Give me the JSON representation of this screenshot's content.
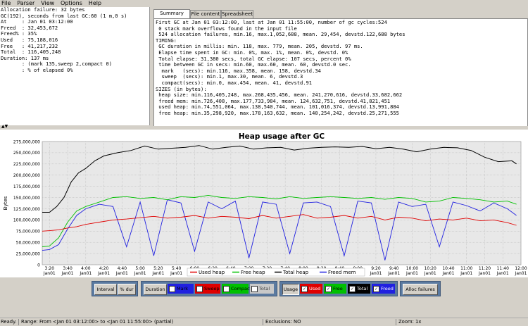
{
  "menu": [
    "File",
    "Parser",
    "View",
    "Options",
    "Help"
  ],
  "left_panel": {
    "lines": [
      "Allocation failure: 32 bytes",
      "GC(192), seconds from last GC:60 (1 m,0 s)",
      "At     : Jan 01 03:12:00",
      "Freed  : 32,453,672",
      "Freed% : 35%",
      "Used   : 75,188,016",
      "Free   : 41,217,232",
      "Total  : 116,405,248",
      "Duration: 137 ms",
      "       : (mark 135,sweep 2,compact 0)",
      "       : % of elapsed 0%"
    ]
  },
  "tabs": [
    {
      "label": "Summary data",
      "active": true
    },
    {
      "label": "File content",
      "active": false
    },
    {
      "label": "Spreadsheet",
      "active": false
    }
  ],
  "summary": {
    "lines": [
      "First GC at Jan 01 03:12:00, last at Jan 01 11:55:00, number of gc cycles:524",
      " 0 stack mark overflows found in the input file",
      " 524 allocation failures, min.16, max.1,052,688, mean. 29,454, devstd.122,688 bytes",
      "TIMING:",
      " GC duration in millis: min. 118, max. 779, mean. 205, devstd. 97 ms.",
      " Elapse time spent in GC: min. 0%, max. 1%, mean. 0%, devstd. 0%",
      " Total elapse: 31,380 secs, total GC elapse: 107 secs, percent 0%",
      " time between GC in secs: min.60, max.60, mean. 60, devstd.0 sec.",
      "  mark   (secs): min.116, max.358, mean. 158, devstd.34",
      "  sweep  (secs): min.1, max.30, mean. 6, devstd.3",
      "  compact(secs): min.0, max.454, mean. 41, devstd.91",
      "SIZES (in bytes):",
      " heap size: min.116,405,248, max.268,435,456, mean. 241,270,616, devstd.33,682,662",
      " freed mem: min.726,408, max.177,733,984, mean. 124,632,751, devstd.41,821,451",
      " used heap: min.74,551,064, max.138,540,744, mean. 101,016,374, devstd.13,991,884",
      " free heap: min.35,298,920, max.178,163,632, mean. 140,254,242, devstd.25,271,555"
    ]
  },
  "chart_data": {
    "type": "line",
    "title": "Heap usage after GC",
    "ylabel": "Bytes",
    "xlabel": "",
    "ylim": [
      0,
      275000000
    ],
    "grid": true,
    "legend_placement": "bottom",
    "y_ticks": [
      0,
      25000000,
      50000000,
      75000000,
      100000000,
      125000000,
      150000000,
      175000000,
      200000000,
      225000000,
      250000000,
      275000000
    ],
    "y_tick_labels": [
      "0",
      "25,000,000",
      "50,000,000",
      "75,000,000",
      "100,000,000",
      "125,000,000",
      "150,000,000",
      "175,000,000",
      "200,000,000",
      "225,000,000",
      "250,000,000",
      "275,000,000"
    ],
    "x_ticks": [
      "03:20",
      "03:40",
      "04:00",
      "04:20",
      "04:40",
      "05:00",
      "05:20",
      "05:40",
      "06:00",
      "06:20",
      "06:40",
      "07:00",
      "07:20",
      "07:40",
      "08:00",
      "08:20",
      "08:40",
      "09:00",
      "09:20",
      "09:40",
      "10:00",
      "10:20",
      "10:40",
      "11:00",
      "11:20",
      "11:40",
      "12:00"
    ],
    "x_tick_labels": [
      {
        "time": "3:20",
        "date": "Jan01"
      },
      {
        "time": "3:40",
        "date": "Jan01"
      },
      {
        "time": "4:00",
        "date": "Jan01"
      },
      {
        "time": "4:20",
        "date": "Jan01"
      },
      {
        "time": "4:40",
        "date": "Jan01"
      },
      {
        "time": "5:00",
        "date": "Jan01"
      },
      {
        "time": "5:20",
        "date": "Jan01"
      },
      {
        "time": "5:40",
        "date": "Jan01"
      },
      {
        "time": "6:00",
        "date": "Jan01"
      },
      {
        "time": "6:20",
        "date": "Jan01"
      },
      {
        "time": "6:40",
        "date": "Jan01"
      },
      {
        "time": "7:00",
        "date": "Jan01"
      },
      {
        "time": "7:20",
        "date": "Jan01"
      },
      {
        "time": "7:40",
        "date": "Jan01"
      },
      {
        "time": "8:00",
        "date": "Jan01"
      },
      {
        "time": "8:20",
        "date": "Jan01"
      },
      {
        "time": "8:40",
        "date": "Jan01"
      },
      {
        "time": "9:00",
        "date": "Jan01"
      },
      {
        "time": "9:20",
        "date": "Jan01"
      },
      {
        "time": "9:40",
        "date": "Jan01"
      },
      {
        "time": "10:00",
        "date": "Jan01"
      },
      {
        "time": "10:20",
        "date": "Jan01"
      },
      {
        "time": "10:40",
        "date": "Jan01"
      },
      {
        "time": "11:00",
        "date": "Jan01"
      },
      {
        "time": "11:20",
        "date": "Jan01"
      },
      {
        "time": "11:40",
        "date": "Jan01"
      },
      {
        "time": "12:00",
        "date": "Jan01"
      }
    ],
    "x_range": [
      "03:12",
      "11:55"
    ],
    "series": [
      {
        "name": "Total heap",
        "color": "#000000",
        "x": [
          "03:12",
          "03:20",
          "03:28",
          "03:36",
          "03:44",
          "03:52",
          "04:00",
          "04:10",
          "04:20",
          "04:35",
          "04:50",
          "05:05",
          "05:20",
          "05:35",
          "05:50",
          "06:05",
          "06:20",
          "06:35",
          "06:50",
          "07:05",
          "07:20",
          "07:35",
          "07:50",
          "08:05",
          "08:20",
          "08:35",
          "08:50",
          "09:05",
          "09:20",
          "09:35",
          "09:50",
          "10:05",
          "10:20",
          "10:35",
          "10:50",
          "11:05",
          "11:20",
          "11:35",
          "11:50",
          "11:55"
        ],
        "values": [
          117000000,
          117000000,
          130000000,
          150000000,
          185000000,
          205000000,
          215000000,
          232000000,
          243000000,
          250000000,
          255000000,
          265000000,
          258000000,
          260000000,
          262000000,
          266000000,
          258000000,
          262000000,
          265000000,
          258000000,
          261000000,
          262000000,
          256000000,
          260000000,
          262000000,
          263000000,
          262000000,
          264000000,
          259000000,
          262000000,
          258000000,
          252000000,
          258000000,
          262000000,
          261000000,
          255000000,
          240000000,
          230000000,
          232000000,
          225000000
        ]
      },
      {
        "name": "Free heap",
        "color": "#00c000",
        "x": [
          "03:12",
          "03:20",
          "03:30",
          "03:40",
          "03:50",
          "04:00",
          "04:15",
          "04:30",
          "04:45",
          "05:00",
          "05:15",
          "05:30",
          "05:45",
          "06:00",
          "06:15",
          "06:30",
          "06:45",
          "07:00",
          "07:15",
          "07:30",
          "07:45",
          "08:00",
          "08:15",
          "08:30",
          "08:45",
          "09:00",
          "09:15",
          "09:30",
          "09:45",
          "10:00",
          "10:15",
          "10:30",
          "10:45",
          "11:00",
          "11:15",
          "11:30",
          "11:45",
          "11:55"
        ],
        "values": [
          40000000,
          42000000,
          60000000,
          95000000,
          120000000,
          130000000,
          140000000,
          150000000,
          152000000,
          148000000,
          150000000,
          145000000,
          152000000,
          150000000,
          155000000,
          150000000,
          148000000,
          152000000,
          150000000,
          147000000,
          152000000,
          148000000,
          150000000,
          152000000,
          150000000,
          148000000,
          150000000,
          146000000,
          150000000,
          148000000,
          140000000,
          142000000,
          150000000,
          148000000,
          145000000,
          140000000,
          142000000,
          135000000
        ]
      },
      {
        "name": "Used heap",
        "color": "#e00000",
        "x": [
          "03:12",
          "03:20",
          "03:30",
          "03:40",
          "03:50",
          "04:00",
          "04:15",
          "04:30",
          "04:45",
          "05:00",
          "05:15",
          "05:30",
          "05:45",
          "06:00",
          "06:15",
          "06:30",
          "06:45",
          "07:00",
          "07:15",
          "07:30",
          "07:45",
          "08:00",
          "08:15",
          "08:30",
          "08:45",
          "09:00",
          "09:15",
          "09:30",
          "09:45",
          "10:00",
          "10:15",
          "10:30",
          "10:45",
          "11:00",
          "11:15",
          "11:30",
          "11:45",
          "11:55"
        ],
        "values": [
          75000000,
          76000000,
          78000000,
          82000000,
          85000000,
          90000000,
          95000000,
          100000000,
          102000000,
          105000000,
          108000000,
          104000000,
          106000000,
          110000000,
          104000000,
          108000000,
          106000000,
          103000000,
          110000000,
          104000000,
          108000000,
          112000000,
          104000000,
          106000000,
          110000000,
          104000000,
          108000000,
          100000000,
          106000000,
          104000000,
          98000000,
          102000000,
          100000000,
          104000000,
          98000000,
          100000000,
          94000000,
          88000000
        ]
      },
      {
        "name": "Freed mem",
        "color": "#2020e0",
        "x": [
          "03:12",
          "03:20",
          "03:30",
          "03:40",
          "03:50",
          "04:00",
          "04:15",
          "04:30",
          "04:45",
          "05:00",
          "05:15",
          "05:30",
          "05:45",
          "06:00",
          "06:15",
          "06:30",
          "06:45",
          "07:00",
          "07:15",
          "07:30",
          "07:45",
          "08:00",
          "08:15",
          "08:30",
          "08:45",
          "09:00",
          "09:15",
          "09:30",
          "09:45",
          "10:00",
          "10:15",
          "10:30",
          "10:45",
          "11:00",
          "11:15",
          "11:30",
          "11:45",
          "11:55"
        ],
        "values": [
          32000000,
          34000000,
          45000000,
          80000000,
          110000000,
          125000000,
          135000000,
          130000000,
          40000000,
          140000000,
          20000000,
          145000000,
          138000000,
          30000000,
          140000000,
          125000000,
          142000000,
          15000000,
          140000000,
          135000000,
          25000000,
          138000000,
          140000000,
          130000000,
          20000000,
          142000000,
          138000000,
          10000000,
          140000000,
          130000000,
          135000000,
          40000000,
          140000000,
          132000000,
          120000000,
          138000000,
          125000000,
          110000000
        ]
      }
    ]
  },
  "legend": [
    "Used heap",
    "Free heap",
    "Total heap",
    "Freed mem"
  ],
  "toolbar": {
    "interval": "Interval",
    "pct_dur": "% dur",
    "duration": "Duration",
    "mark": "Mark",
    "sweep": "Sweep",
    "compact": "Compact",
    "total": "Total",
    "usage": "Usage",
    "used": "Used",
    "free": "Free",
    "total2": "Total",
    "freed": "Freed",
    "alloc_failures": "Alloc failures",
    "colors": {
      "mark": "#2020e0",
      "sweep": "#e00000",
      "compact": "#00c000",
      "total": "#000000",
      "used": "#e00000",
      "free": "#00c000",
      "total2": "#000000",
      "freed": "#2020e0"
    }
  },
  "status": {
    "ready": "Ready.",
    "range": "Range: From <Jan 01 03:12:00> to <Jan 01 11:55:00> (partial)",
    "exclusions": "Exclusions: NO",
    "zoom": "Zoom: 1x"
  }
}
